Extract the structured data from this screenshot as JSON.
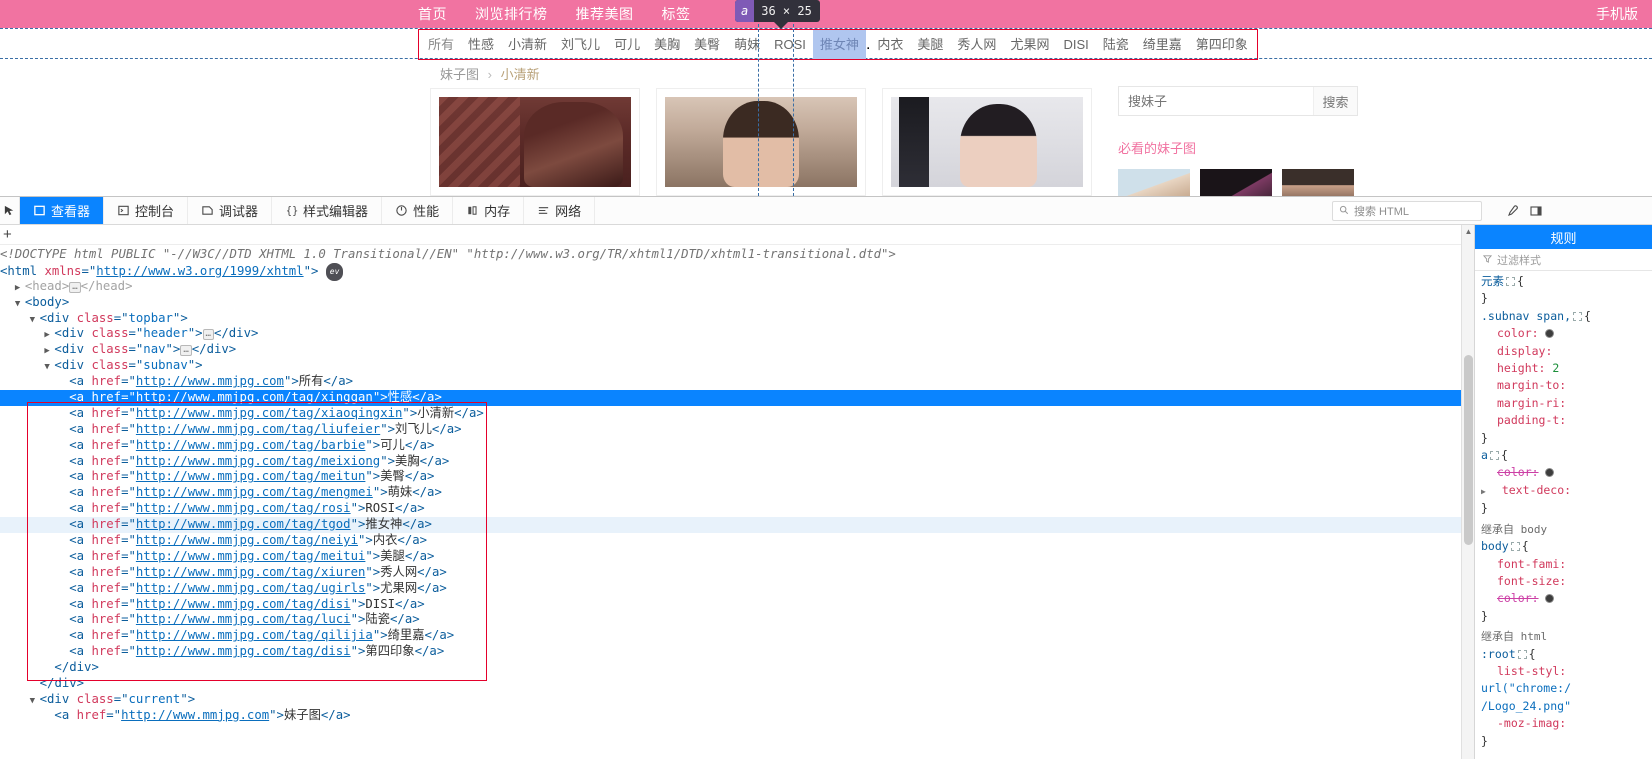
{
  "page": {
    "topnav": [
      {
        "label": "首页",
        "name": "nav-home"
      },
      {
        "label": "浏览排行榜",
        "name": "nav-ranking"
      },
      {
        "label": "推荐美图",
        "name": "nav-recommend"
      },
      {
        "label": "标签",
        "name": "nav-tags"
      }
    ],
    "mobile_link": "手机版",
    "subnav": [
      {
        "label": "所有"
      },
      {
        "label": "性感"
      },
      {
        "label": "小清新"
      },
      {
        "label": "刘飞儿"
      },
      {
        "label": "可儿"
      },
      {
        "label": "美胸"
      },
      {
        "label": "美臀"
      },
      {
        "label": "萌妹"
      },
      {
        "label": "ROSI"
      },
      {
        "label": "推女神"
      },
      {
        "label": "内衣"
      },
      {
        "label": "美腿"
      },
      {
        "label": "秀人网"
      },
      {
        "label": "尤果网"
      },
      {
        "label": "DISI"
      },
      {
        "label": "陆瓷"
      },
      {
        "label": "绮里嘉"
      },
      {
        "label": "第四印象"
      }
    ],
    "breadcrumb": {
      "root": "妹子图",
      "sep": "›",
      "current": "小清新"
    },
    "search": {
      "placeholder": "搜妹子",
      "value": "",
      "button": "搜索"
    },
    "sidebar_title": "必看的妹子图",
    "tooltip": {
      "tag": "a",
      "size": "36 × 25"
    }
  },
  "devtools": {
    "tabs": [
      {
        "label": "查看器",
        "icon": "inspector-icon",
        "active": true
      },
      {
        "label": "控制台",
        "icon": "console-icon",
        "active": false
      },
      {
        "label": "调试器",
        "icon": "debugger-icon",
        "active": false
      },
      {
        "label": "样式编辑器",
        "icon": "style-editor-icon",
        "active": false
      },
      {
        "label": "性能",
        "icon": "performance-icon",
        "active": false
      },
      {
        "label": "内存",
        "icon": "memory-icon",
        "active": false
      },
      {
        "label": "网络",
        "icon": "network-icon",
        "active": false
      }
    ],
    "search_placeholder": "搜索 HTML",
    "add_node_label": "+",
    "markup": [
      {
        "indent": 0,
        "twisty": "",
        "kind": "doctype",
        "text": "<!DOCTYPE html PUBLIC \"-//W3C//DTD XHTML 1.0 Transitional//EN\" \"http://www.w3.org/TR/xhtml1/DTD/xhtml1-transitional.dtd\">"
      },
      {
        "indent": 0,
        "twisty": "",
        "kind": "html-open",
        "tag": "html",
        "attr": "xmlns",
        "val": "http://www.w3.org/1999/xhtml",
        "badge": "ev"
      },
      {
        "indent": 1,
        "twisty": "▶",
        "kind": "collapsed",
        "tag": "head"
      },
      {
        "indent": 1,
        "twisty": "▼",
        "kind": "open",
        "tag": "body"
      },
      {
        "indent": 2,
        "twisty": "▼",
        "kind": "open-class",
        "tag": "div",
        "attr": "class",
        "val": "topbar"
      },
      {
        "indent": 3,
        "twisty": "▶",
        "kind": "collapsed-class",
        "tag": "div",
        "attr": "class",
        "val": "header"
      },
      {
        "indent": 3,
        "twisty": "▶",
        "kind": "collapsed-class",
        "tag": "div",
        "attr": "class",
        "val": "nav"
      },
      {
        "indent": 3,
        "twisty": "▼",
        "kind": "open-class",
        "tag": "div",
        "attr": "class",
        "val": "subnav"
      },
      {
        "indent": 4,
        "twisty": "",
        "kind": "anchor",
        "href": "http://www.mmjpg.com",
        "text": "所有"
      },
      {
        "indent": 4,
        "twisty": "",
        "kind": "anchor",
        "href": "http://www.mmjpg.com/tag/xinggan",
        "text": "性感",
        "state": "selected"
      },
      {
        "indent": 4,
        "twisty": "",
        "kind": "anchor",
        "href": "http://www.mmjpg.com/tag/xiaoqingxin",
        "text": "小清新"
      },
      {
        "indent": 4,
        "twisty": "",
        "kind": "anchor",
        "href": "http://www.mmjpg.com/tag/liufeier",
        "text": "刘飞儿"
      },
      {
        "indent": 4,
        "twisty": "",
        "kind": "anchor",
        "href": "http://www.mmjpg.com/tag/barbie",
        "text": "可儿"
      },
      {
        "indent": 4,
        "twisty": "",
        "kind": "anchor",
        "href": "http://www.mmjpg.com/tag/meixiong",
        "text": "美胸"
      },
      {
        "indent": 4,
        "twisty": "",
        "kind": "anchor",
        "href": "http://www.mmjpg.com/tag/meitun",
        "text": "美臀"
      },
      {
        "indent": 4,
        "twisty": "",
        "kind": "anchor",
        "href": "http://www.mmjpg.com/tag/mengmei",
        "text": "萌妹"
      },
      {
        "indent": 4,
        "twisty": "",
        "kind": "anchor",
        "href": "http://www.mmjpg.com/tag/rosi",
        "text": "ROSI"
      },
      {
        "indent": 4,
        "twisty": "",
        "kind": "anchor",
        "href": "http://www.mmjpg.com/tag/tgod",
        "text": "推女神",
        "state": "hovered"
      },
      {
        "indent": 4,
        "twisty": "",
        "kind": "anchor",
        "href": "http://www.mmjpg.com/tag/neiyi",
        "text": "内衣"
      },
      {
        "indent": 4,
        "twisty": "",
        "kind": "anchor",
        "href": "http://www.mmjpg.com/tag/meitui",
        "text": "美腿"
      },
      {
        "indent": 4,
        "twisty": "",
        "kind": "anchor",
        "href": "http://www.mmjpg.com/tag/xiuren",
        "text": "秀人网"
      },
      {
        "indent": 4,
        "twisty": "",
        "kind": "anchor",
        "href": "http://www.mmjpg.com/tag/ugirls",
        "text": "尤果网"
      },
      {
        "indent": 4,
        "twisty": "",
        "kind": "anchor",
        "href": "http://www.mmjpg.com/tag/disi",
        "text": "DISI"
      },
      {
        "indent": 4,
        "twisty": "",
        "kind": "anchor",
        "href": "http://www.mmjpg.com/tag/luci",
        "text": "陆瓷"
      },
      {
        "indent": 4,
        "twisty": "",
        "kind": "anchor",
        "href": "http://www.mmjpg.com/tag/qilijia",
        "text": "绮里嘉"
      },
      {
        "indent": 4,
        "twisty": "",
        "kind": "anchor",
        "href": "http://www.mmjpg.com/tag/disi",
        "text": "第四印象"
      },
      {
        "indent": 3,
        "twisty": "",
        "kind": "close",
        "tag": "div"
      },
      {
        "indent": 2,
        "twisty": "",
        "kind": "close",
        "tag": "div"
      },
      {
        "indent": 2,
        "twisty": "▼",
        "kind": "open-class",
        "tag": "div",
        "attr": "class",
        "val": "current"
      },
      {
        "indent": 3,
        "twisty": "",
        "kind": "anchor",
        "href": "http://www.mmjpg.com",
        "text": "妹子图"
      }
    ],
    "rules": {
      "tab_label": "规则",
      "filter_placeholder": "过滤样式",
      "blocks": [
        {
          "selector": "元素",
          "decls": []
        },
        {
          "selector": ".subnav span,",
          "decls": [
            {
              "prop": "color",
              "value": "",
              "swatch": true
            },
            {
              "prop": "display",
              "value": ""
            },
            {
              "prop": "height",
              "value": "2"
            },
            {
              "prop": "margin-to",
              "value": ""
            },
            {
              "prop": "margin-ri",
              "value": ""
            },
            {
              "prop": "padding-t",
              "value": ""
            }
          ]
        },
        {
          "selector": "a",
          "decls": [
            {
              "prop": "color",
              "value": "",
              "swatch": true,
              "struck": true
            },
            {
              "prop": "text-deco",
              "value": "",
              "expandable": true
            }
          ]
        },
        {
          "inherited_from": "继承自 body"
        },
        {
          "selector": "body",
          "decls": [
            {
              "prop": "font-fami",
              "value": ""
            },
            {
              "prop": "font-size",
              "value": ""
            },
            {
              "prop": "color",
              "value": "",
              "swatch": true,
              "struck": true
            }
          ]
        },
        {
          "inherited_from": "继承自 html"
        },
        {
          "selector": ":root",
          "decls": [
            {
              "prop": "list-styl",
              "value": ""
            },
            {
              "raw": "url(\"chrome:/"
            },
            {
              "raw": "/Logo_24.png\""
            },
            {
              "prop": "-moz-imag",
              "value": ""
            }
          ]
        }
      ]
    }
  }
}
